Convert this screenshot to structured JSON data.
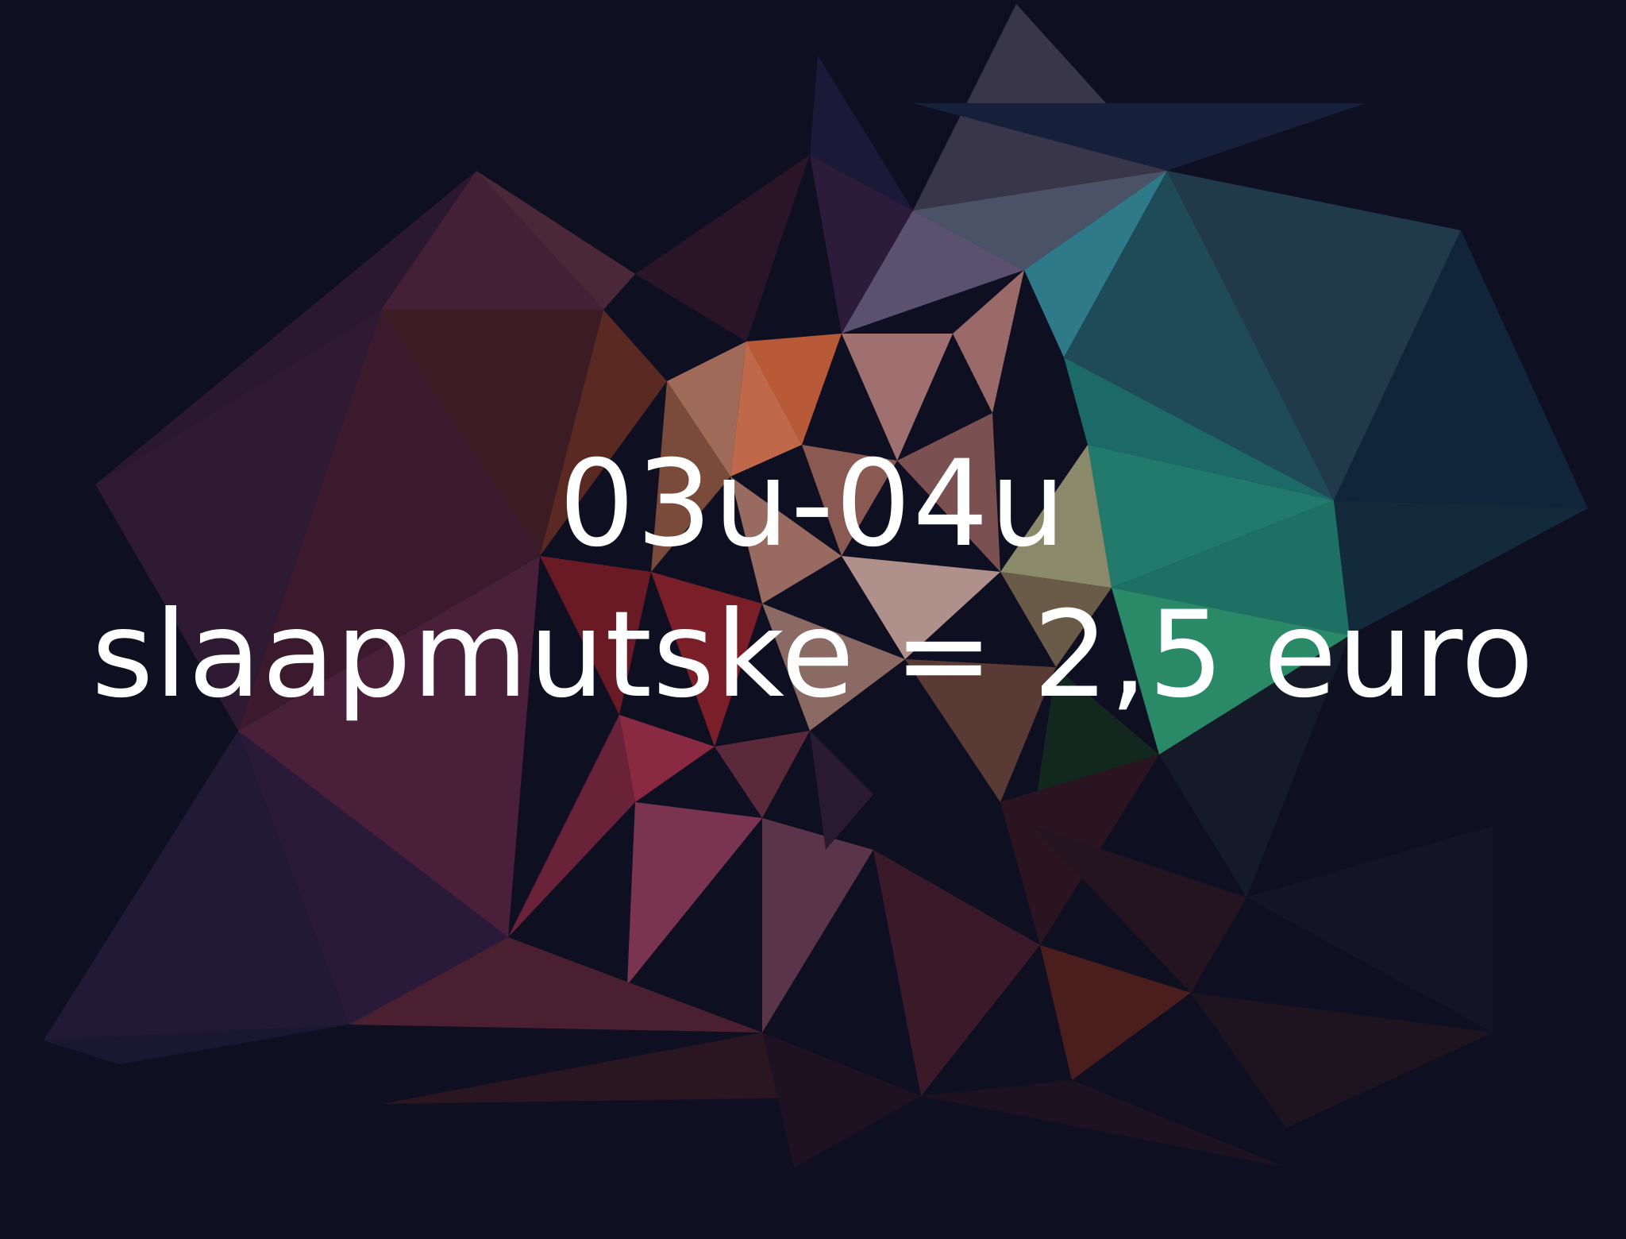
{
  "poster": {
    "time_range": "03u-04u",
    "price_line": "slaapmutske = 2,5 euro"
  },
  "colors": {
    "background": "#0e1022",
    "text": "#ffffff",
    "warm_center": "#c0684a",
    "teal_accent": "#1f8a82",
    "crimson": "#7a2236",
    "purple": "#3a2240"
  },
  "decor": {
    "background_art": "low-poly-geometric-abstract"
  }
}
